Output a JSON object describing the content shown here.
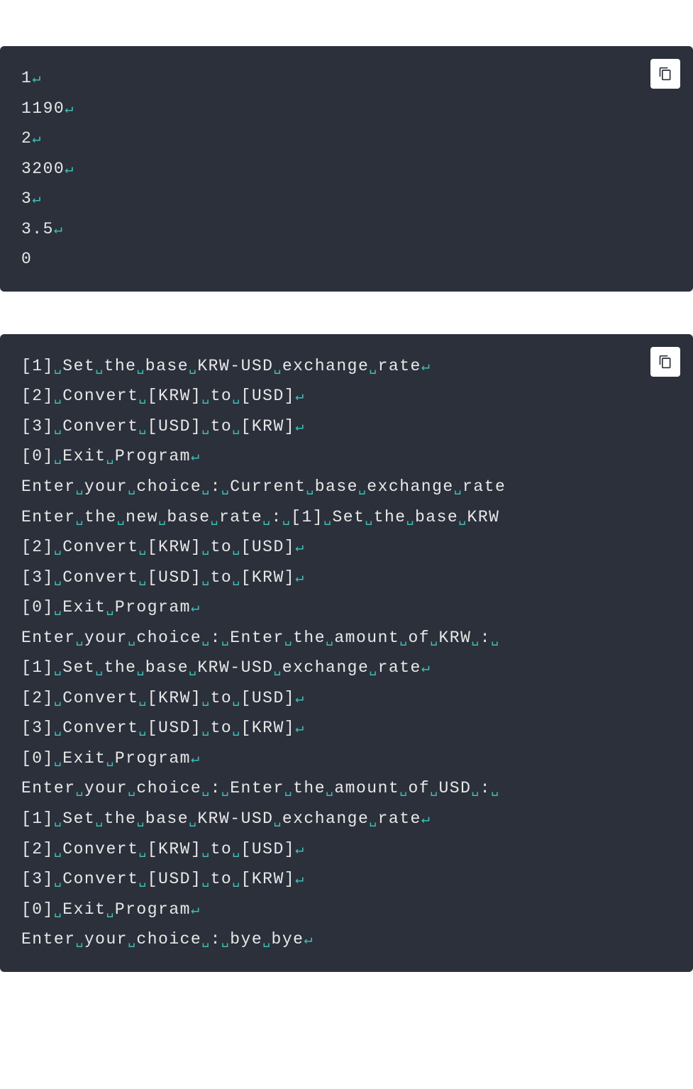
{
  "block1": {
    "lines": [
      [
        {
          "t": "1",
          "c": "txt"
        },
        {
          "t": "",
          "c": "nl"
        }
      ],
      [
        {
          "t": "1190",
          "c": "txt"
        },
        {
          "t": "",
          "c": "nl"
        }
      ],
      [
        {
          "t": "2",
          "c": "txt"
        },
        {
          "t": "",
          "c": "nl"
        }
      ],
      [
        {
          "t": "3200",
          "c": "txt"
        },
        {
          "t": "",
          "c": "nl"
        }
      ],
      [
        {
          "t": "3",
          "c": "txt"
        },
        {
          "t": "",
          "c": "nl"
        }
      ],
      [
        {
          "t": "3.5",
          "c": "txt"
        },
        {
          "t": "",
          "c": "nl"
        }
      ],
      [
        {
          "t": "0",
          "c": "txt"
        }
      ]
    ]
  },
  "block2": {
    "lines": [
      [
        {
          "t": "[1]",
          "c": "txt"
        },
        {
          "t": "",
          "c": "sp"
        },
        {
          "t": "Set",
          "c": "txt"
        },
        {
          "t": "",
          "c": "sp"
        },
        {
          "t": "the",
          "c": "txt"
        },
        {
          "t": "",
          "c": "sp"
        },
        {
          "t": "base",
          "c": "txt"
        },
        {
          "t": "",
          "c": "sp"
        },
        {
          "t": "KRW-USD",
          "c": "txt"
        },
        {
          "t": "",
          "c": "sp"
        },
        {
          "t": "exchange",
          "c": "txt"
        },
        {
          "t": "",
          "c": "sp"
        },
        {
          "t": "rate",
          "c": "txt"
        },
        {
          "t": "",
          "c": "nl"
        }
      ],
      [
        {
          "t": "[2]",
          "c": "txt"
        },
        {
          "t": "",
          "c": "sp"
        },
        {
          "t": "Convert",
          "c": "txt"
        },
        {
          "t": "",
          "c": "sp"
        },
        {
          "t": "[KRW]",
          "c": "txt"
        },
        {
          "t": "",
          "c": "sp"
        },
        {
          "t": "to",
          "c": "txt"
        },
        {
          "t": "",
          "c": "sp"
        },
        {
          "t": "[USD]",
          "c": "txt"
        },
        {
          "t": "",
          "c": "nl"
        }
      ],
      [
        {
          "t": "[3]",
          "c": "txt"
        },
        {
          "t": "",
          "c": "sp"
        },
        {
          "t": "Convert",
          "c": "txt"
        },
        {
          "t": "",
          "c": "sp"
        },
        {
          "t": "[USD]",
          "c": "txt"
        },
        {
          "t": "",
          "c": "sp"
        },
        {
          "t": "to",
          "c": "txt"
        },
        {
          "t": "",
          "c": "sp"
        },
        {
          "t": "[KRW]",
          "c": "txt"
        },
        {
          "t": "",
          "c": "nl"
        }
      ],
      [
        {
          "t": "[0]",
          "c": "txt"
        },
        {
          "t": "",
          "c": "sp"
        },
        {
          "t": "Exit",
          "c": "txt"
        },
        {
          "t": "",
          "c": "sp"
        },
        {
          "t": "Program",
          "c": "txt"
        },
        {
          "t": "",
          "c": "nl"
        }
      ],
      [
        {
          "t": "Enter",
          "c": "txt"
        },
        {
          "t": "",
          "c": "sp"
        },
        {
          "t": "your",
          "c": "txt"
        },
        {
          "t": "",
          "c": "sp"
        },
        {
          "t": "choice",
          "c": "txt"
        },
        {
          "t": "",
          "c": "sp"
        },
        {
          "t": ":",
          "c": "txt"
        },
        {
          "t": "",
          "c": "sp"
        },
        {
          "t": "Current",
          "c": "txt"
        },
        {
          "t": "",
          "c": "sp"
        },
        {
          "t": "base",
          "c": "txt"
        },
        {
          "t": "",
          "c": "sp"
        },
        {
          "t": "exchange",
          "c": "txt"
        },
        {
          "t": "",
          "c": "sp"
        },
        {
          "t": "rate",
          "c": "txt"
        }
      ],
      [
        {
          "t": "Enter",
          "c": "txt"
        },
        {
          "t": "",
          "c": "sp"
        },
        {
          "t": "the",
          "c": "txt"
        },
        {
          "t": "",
          "c": "sp"
        },
        {
          "t": "new",
          "c": "txt"
        },
        {
          "t": "",
          "c": "sp"
        },
        {
          "t": "base",
          "c": "txt"
        },
        {
          "t": "",
          "c": "sp"
        },
        {
          "t": "rate",
          "c": "txt"
        },
        {
          "t": "",
          "c": "sp"
        },
        {
          "t": ":",
          "c": "txt"
        },
        {
          "t": "",
          "c": "sp"
        },
        {
          "t": "[1]",
          "c": "txt"
        },
        {
          "t": "",
          "c": "sp"
        },
        {
          "t": "Set",
          "c": "txt"
        },
        {
          "t": "",
          "c": "sp"
        },
        {
          "t": "the",
          "c": "txt"
        },
        {
          "t": "",
          "c": "sp"
        },
        {
          "t": "base",
          "c": "txt"
        },
        {
          "t": "",
          "c": "sp"
        },
        {
          "t": "KRW",
          "c": "txt"
        }
      ],
      [
        {
          "t": "[2]",
          "c": "txt"
        },
        {
          "t": "",
          "c": "sp"
        },
        {
          "t": "Convert",
          "c": "txt"
        },
        {
          "t": "",
          "c": "sp"
        },
        {
          "t": "[KRW]",
          "c": "txt"
        },
        {
          "t": "",
          "c": "sp"
        },
        {
          "t": "to",
          "c": "txt"
        },
        {
          "t": "",
          "c": "sp"
        },
        {
          "t": "[USD]",
          "c": "txt"
        },
        {
          "t": "",
          "c": "nl"
        }
      ],
      [
        {
          "t": "[3]",
          "c": "txt"
        },
        {
          "t": "",
          "c": "sp"
        },
        {
          "t": "Convert",
          "c": "txt"
        },
        {
          "t": "",
          "c": "sp"
        },
        {
          "t": "[USD]",
          "c": "txt"
        },
        {
          "t": "",
          "c": "sp"
        },
        {
          "t": "to",
          "c": "txt"
        },
        {
          "t": "",
          "c": "sp"
        },
        {
          "t": "[KRW]",
          "c": "txt"
        },
        {
          "t": "",
          "c": "nl"
        }
      ],
      [
        {
          "t": "[0]",
          "c": "txt"
        },
        {
          "t": "",
          "c": "sp"
        },
        {
          "t": "Exit",
          "c": "txt"
        },
        {
          "t": "",
          "c": "sp"
        },
        {
          "t": "Program",
          "c": "txt"
        },
        {
          "t": "",
          "c": "nl"
        }
      ],
      [
        {
          "t": "Enter",
          "c": "txt"
        },
        {
          "t": "",
          "c": "sp"
        },
        {
          "t": "your",
          "c": "txt"
        },
        {
          "t": "",
          "c": "sp"
        },
        {
          "t": "choice",
          "c": "txt"
        },
        {
          "t": "",
          "c": "sp"
        },
        {
          "t": ":",
          "c": "txt"
        },
        {
          "t": "",
          "c": "sp"
        },
        {
          "t": "Enter",
          "c": "txt"
        },
        {
          "t": "",
          "c": "sp"
        },
        {
          "t": "the",
          "c": "txt"
        },
        {
          "t": "",
          "c": "sp"
        },
        {
          "t": "amount",
          "c": "txt"
        },
        {
          "t": "",
          "c": "sp"
        },
        {
          "t": "of",
          "c": "txt"
        },
        {
          "t": "",
          "c": "sp"
        },
        {
          "t": "KRW",
          "c": "txt"
        },
        {
          "t": "",
          "c": "sp"
        },
        {
          "t": ":",
          "c": "txt"
        },
        {
          "t": "",
          "c": "sp"
        }
      ],
      [
        {
          "t": "[1]",
          "c": "txt"
        },
        {
          "t": "",
          "c": "sp"
        },
        {
          "t": "Set",
          "c": "txt"
        },
        {
          "t": "",
          "c": "sp"
        },
        {
          "t": "the",
          "c": "txt"
        },
        {
          "t": "",
          "c": "sp"
        },
        {
          "t": "base",
          "c": "txt"
        },
        {
          "t": "",
          "c": "sp"
        },
        {
          "t": "KRW-USD",
          "c": "txt"
        },
        {
          "t": "",
          "c": "sp"
        },
        {
          "t": "exchange",
          "c": "txt"
        },
        {
          "t": "",
          "c": "sp"
        },
        {
          "t": "rate",
          "c": "txt"
        },
        {
          "t": "",
          "c": "nl"
        }
      ],
      [
        {
          "t": "[2]",
          "c": "txt"
        },
        {
          "t": "",
          "c": "sp"
        },
        {
          "t": "Convert",
          "c": "txt"
        },
        {
          "t": "",
          "c": "sp"
        },
        {
          "t": "[KRW]",
          "c": "txt"
        },
        {
          "t": "",
          "c": "sp"
        },
        {
          "t": "to",
          "c": "txt"
        },
        {
          "t": "",
          "c": "sp"
        },
        {
          "t": "[USD]",
          "c": "txt"
        },
        {
          "t": "",
          "c": "nl"
        }
      ],
      [
        {
          "t": "[3]",
          "c": "txt"
        },
        {
          "t": "",
          "c": "sp"
        },
        {
          "t": "Convert",
          "c": "txt"
        },
        {
          "t": "",
          "c": "sp"
        },
        {
          "t": "[USD]",
          "c": "txt"
        },
        {
          "t": "",
          "c": "sp"
        },
        {
          "t": "to",
          "c": "txt"
        },
        {
          "t": "",
          "c": "sp"
        },
        {
          "t": "[KRW]",
          "c": "txt"
        },
        {
          "t": "",
          "c": "nl"
        }
      ],
      [
        {
          "t": "[0]",
          "c": "txt"
        },
        {
          "t": "",
          "c": "sp"
        },
        {
          "t": "Exit",
          "c": "txt"
        },
        {
          "t": "",
          "c": "sp"
        },
        {
          "t": "Program",
          "c": "txt"
        },
        {
          "t": "",
          "c": "nl"
        }
      ],
      [
        {
          "t": "Enter",
          "c": "txt"
        },
        {
          "t": "",
          "c": "sp"
        },
        {
          "t": "your",
          "c": "txt"
        },
        {
          "t": "",
          "c": "sp"
        },
        {
          "t": "choice",
          "c": "txt"
        },
        {
          "t": "",
          "c": "sp"
        },
        {
          "t": ":",
          "c": "txt"
        },
        {
          "t": "",
          "c": "sp"
        },
        {
          "t": "Enter",
          "c": "txt"
        },
        {
          "t": "",
          "c": "sp"
        },
        {
          "t": "the",
          "c": "txt"
        },
        {
          "t": "",
          "c": "sp"
        },
        {
          "t": "amount",
          "c": "txt"
        },
        {
          "t": "",
          "c": "sp"
        },
        {
          "t": "of",
          "c": "txt"
        },
        {
          "t": "",
          "c": "sp"
        },
        {
          "t": "USD",
          "c": "txt"
        },
        {
          "t": "",
          "c": "sp"
        },
        {
          "t": ":",
          "c": "txt"
        },
        {
          "t": "",
          "c": "sp"
        }
      ],
      [
        {
          "t": "[1]",
          "c": "txt"
        },
        {
          "t": "",
          "c": "sp"
        },
        {
          "t": "Set",
          "c": "txt"
        },
        {
          "t": "",
          "c": "sp"
        },
        {
          "t": "the",
          "c": "txt"
        },
        {
          "t": "",
          "c": "sp"
        },
        {
          "t": "base",
          "c": "txt"
        },
        {
          "t": "",
          "c": "sp"
        },
        {
          "t": "KRW-USD",
          "c": "txt"
        },
        {
          "t": "",
          "c": "sp"
        },
        {
          "t": "exchange",
          "c": "txt"
        },
        {
          "t": "",
          "c": "sp"
        },
        {
          "t": "rate",
          "c": "txt"
        },
        {
          "t": "",
          "c": "nl"
        }
      ],
      [
        {
          "t": "[2]",
          "c": "txt"
        },
        {
          "t": "",
          "c": "sp"
        },
        {
          "t": "Convert",
          "c": "txt"
        },
        {
          "t": "",
          "c": "sp"
        },
        {
          "t": "[KRW]",
          "c": "txt"
        },
        {
          "t": "",
          "c": "sp"
        },
        {
          "t": "to",
          "c": "txt"
        },
        {
          "t": "",
          "c": "sp"
        },
        {
          "t": "[USD]",
          "c": "txt"
        },
        {
          "t": "",
          "c": "nl"
        }
      ],
      [
        {
          "t": "[3]",
          "c": "txt"
        },
        {
          "t": "",
          "c": "sp"
        },
        {
          "t": "Convert",
          "c": "txt"
        },
        {
          "t": "",
          "c": "sp"
        },
        {
          "t": "[USD]",
          "c": "txt"
        },
        {
          "t": "",
          "c": "sp"
        },
        {
          "t": "to",
          "c": "txt"
        },
        {
          "t": "",
          "c": "sp"
        },
        {
          "t": "[KRW]",
          "c": "txt"
        },
        {
          "t": "",
          "c": "nl"
        }
      ],
      [
        {
          "t": "[0]",
          "c": "txt"
        },
        {
          "t": "",
          "c": "sp"
        },
        {
          "t": "Exit",
          "c": "txt"
        },
        {
          "t": "",
          "c": "sp"
        },
        {
          "t": "Program",
          "c": "txt"
        },
        {
          "t": "",
          "c": "nl"
        }
      ],
      [
        {
          "t": "Enter",
          "c": "txt"
        },
        {
          "t": "",
          "c": "sp"
        },
        {
          "t": "your",
          "c": "txt"
        },
        {
          "t": "",
          "c": "sp"
        },
        {
          "t": "choice",
          "c": "txt"
        },
        {
          "t": "",
          "c": "sp"
        },
        {
          "t": ":",
          "c": "txt"
        },
        {
          "t": "",
          "c": "sp"
        },
        {
          "t": "bye",
          "c": "txt"
        },
        {
          "t": "",
          "c": "sp"
        },
        {
          "t": "bye",
          "c": "txt"
        },
        {
          "t": "",
          "c": "nl"
        }
      ]
    ]
  }
}
